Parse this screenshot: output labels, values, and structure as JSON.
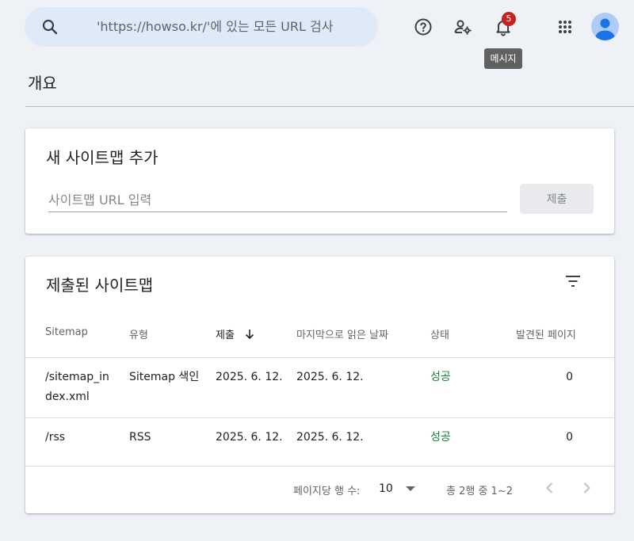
{
  "search": {
    "placeholder": "'https://howso.kr/'에 있는 모든 URL 검사"
  },
  "header": {
    "notification_count": "5",
    "tooltip": "메시지"
  },
  "page": {
    "title": "개요"
  },
  "add_sitemap": {
    "title": "새 사이트맵 추가",
    "input_placeholder": "사이트맵 URL 입력",
    "submit_label": "제출"
  },
  "submitted": {
    "title": "제출된 사이트맵",
    "columns": [
      "Sitemap",
      "유형",
      "제출",
      "마지막으로 읽은 날짜",
      "상태",
      "발견된 페이지"
    ],
    "sort_column": "제출",
    "rows": [
      {
        "sitemap_line1": "/sitemap_in",
        "sitemap_line2": "dex.xml",
        "type": "Sitemap 색인",
        "submitted": "2025. 6. 12.",
        "last_read": "2025. 6. 12.",
        "status": "성공",
        "pages": "0"
      },
      {
        "sitemap_line1": "/rss",
        "sitemap_line2": "",
        "type": "RSS",
        "submitted": "2025. 6. 12.",
        "last_read": "2025. 6. 12.",
        "status": "성공",
        "pages": "0"
      }
    ],
    "pagination": {
      "rows_per_page_label": "페이지당 행 수:",
      "rows_per_page": "10",
      "range_text": "총 2행 중 1~2"
    }
  },
  "colors": {
    "status_ok": "#188038",
    "badge": "#c5221f",
    "search_bg": "#dfe9f8"
  }
}
